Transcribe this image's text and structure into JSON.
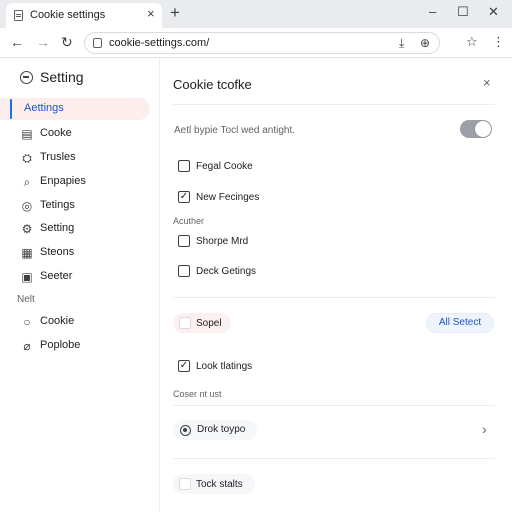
{
  "browser": {
    "tab_title": "Cookie settings",
    "tab_close": "×",
    "new_tab": "+",
    "window_controls": {
      "minimize": "–",
      "maximize": "☐",
      "close": "✕"
    },
    "nav": {
      "back": "←",
      "forward": "→",
      "reload": "↻"
    },
    "url": "cookie-settings.com/",
    "icons": {
      "download": "⤓",
      "extension": "⊕",
      "bookmark": "☆",
      "menu": "⋮"
    }
  },
  "sidebar": {
    "title": "Setting",
    "items": [
      {
        "label": "Aettings",
        "icon": "",
        "active": true
      },
      {
        "label": "Cooke",
        "icon": "▤",
        "active": false
      },
      {
        "label": "Trusles",
        "icon": "⛭",
        "active": false
      },
      {
        "label": "Enpapies",
        "icon": "⌕",
        "active": false
      },
      {
        "label": "Tetings",
        "icon": "◎",
        "active": false
      },
      {
        "label": "Setting",
        "icon": "⚙",
        "active": false
      },
      {
        "label": "Steons",
        "icon": "▦",
        "active": false
      },
      {
        "label": "Seeter",
        "icon": "▣",
        "active": false
      }
    ],
    "section_label": "Nelt",
    "extra_items": [
      {
        "label": "Cookie",
        "icon": "○"
      },
      {
        "label": "Poplobe",
        "icon": "⌀"
      }
    ]
  },
  "main": {
    "panel_title": "Cookie tcofke",
    "close_icon": "×",
    "description": "Aetl bypie Tocl wed antight.",
    "toggle_on": true,
    "options": [
      {
        "label": "Fegal Cooke",
        "checked": false
      },
      {
        "label": "New Fecinges",
        "checked": true
      }
    ],
    "section1": "Acuther",
    "options2": [
      {
        "label": "Shorpe Mrd",
        "checked": false
      },
      {
        "label": "Deck Getings",
        "checked": false
      }
    ],
    "chip_label": "Sopel",
    "chip_button": "All Setect",
    "look_option": {
      "label": "Look tlatings",
      "checked": true
    },
    "section2": "Coser nt ust",
    "radio_label": "Drok toypo",
    "last_option": "Tock stalts"
  }
}
